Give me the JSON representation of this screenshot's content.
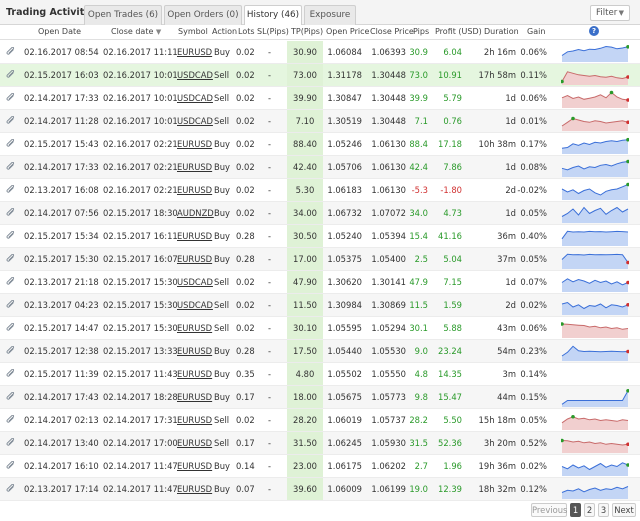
{
  "title": "Trading Activity",
  "tabs": [
    {
      "label": "Open Trades (6)",
      "active": false
    },
    {
      "label": "Open Orders (0)",
      "active": false
    },
    {
      "label": "History (46)",
      "active": true
    },
    {
      "label": "Exposure",
      "active": false
    }
  ],
  "filter": {
    "label": "Filter",
    "caret": "▼"
  },
  "columns": {
    "open_date": "Open Date",
    "close_date": "Close date",
    "close_sort": "▼",
    "symbol": "Symbol",
    "action": "Action",
    "lots": "Lots",
    "sl": "SL(Pips)",
    "tp": "TP(Pips)",
    "open_price": "Open Price",
    "close_price": "Close Price",
    "pips": "Pips",
    "profit": "Profit (USD)",
    "duration": "Duration",
    "gain": "Gain",
    "help": "?"
  },
  "colors": {
    "positive": "#2a9a2a",
    "negative": "#d03030",
    "spark_blue_line": "#3a6fd8",
    "spark_blue_fill": "#c3d5f5",
    "spark_red_line": "#c86a6a",
    "spark_red_fill": "#f1cfcf",
    "highlight_row": "#e5f6df"
  },
  "rows": [
    {
      "open": "02.16.2017 08:54",
      "close": "02.16.2017 11:11",
      "symbol": "EURUSD",
      "action": "Buy",
      "lots": "0.02",
      "sl": "-",
      "tp": "30.90",
      "open_price": "1.06084",
      "close_price": "1.06393",
      "pips": "30.9",
      "profit": "6.04",
      "duration": "2h 16m",
      "gain": "0.06%",
      "neg": false,
      "spark": {
        "color": "blue",
        "values": [
          0.3,
          0.55,
          0.6,
          0.7,
          0.62,
          0.72,
          0.7,
          0.78,
          0.9,
          0.86,
          0.75,
          0.8,
          0.88
        ],
        "end": "green"
      }
    },
    {
      "open": "02.15.2017 16:03",
      "close": "02.16.2017 10:01",
      "symbol": "USDCAD",
      "action": "Sell",
      "lots": "0.02",
      "sl": "-",
      "tp": "73.00",
      "open_price": "1.31178",
      "close_price": "1.30448",
      "pips": "73.0",
      "profit": "10.91",
      "duration": "17h 58m",
      "gain": "0.11%",
      "neg": false,
      "highlight": true,
      "spark": {
        "color": "red",
        "values": [
          0.1,
          0.75,
          0.65,
          0.55,
          0.5,
          0.45,
          0.5,
          0.42,
          0.38,
          0.45,
          0.35,
          0.3,
          0.4
        ],
        "end": "red",
        "start": "green"
      }
    },
    {
      "open": "02.14.2017 17:33",
      "close": "02.16.2017 10:01",
      "symbol": "USDCAD",
      "action": "Sell",
      "lots": "0.02",
      "sl": "-",
      "tp": "39.90",
      "open_price": "1.30847",
      "close_price": "1.30448",
      "pips": "39.9",
      "profit": "5.79",
      "duration": "1d",
      "gain": "0.06%",
      "neg": false,
      "spark": {
        "color": "red",
        "values": [
          0.55,
          0.7,
          0.5,
          0.6,
          0.45,
          0.52,
          0.6,
          0.75,
          0.55,
          0.9,
          0.6,
          0.45,
          0.4
        ],
        "end": "red",
        "peak": "green"
      }
    },
    {
      "open": "02.14.2017 11:28",
      "close": "02.16.2017 10:01",
      "symbol": "USDCAD",
      "action": "Sell",
      "lots": "0.02",
      "sl": "-",
      "tp": "7.10",
      "open_price": "1.30519",
      "close_price": "1.30448",
      "pips": "7.1",
      "profit": "0.76",
      "duration": "1d",
      "gain": "0.01%",
      "neg": false,
      "spark": {
        "color": "red",
        "values": [
          0.2,
          0.45,
          0.7,
          0.6,
          0.5,
          0.45,
          0.55,
          0.5,
          0.4,
          0.45,
          0.5,
          0.55,
          0.45
        ],
        "end": "red",
        "peak": "green"
      }
    },
    {
      "open": "02.15.2017 15:43",
      "close": "02.16.2017 02:21",
      "symbol": "EURUSD",
      "action": "Buy",
      "lots": "0.02",
      "sl": "-",
      "tp": "88.40",
      "open_price": "1.05246",
      "close_price": "1.06130",
      "pips": "88.4",
      "profit": "17.18",
      "duration": "10h 38m",
      "gain": "0.17%",
      "neg": false,
      "spark": {
        "color": "blue",
        "values": [
          0.25,
          0.3,
          0.55,
          0.45,
          0.6,
          0.5,
          0.65,
          0.6,
          0.7,
          0.75,
          0.7,
          0.78,
          0.82
        ],
        "end": "green"
      }
    },
    {
      "open": "02.14.2017 17:33",
      "close": "02.16.2017 02:21",
      "symbol": "EURUSD",
      "action": "Buy",
      "lots": "0.02",
      "sl": "-",
      "tp": "42.40",
      "open_price": "1.05706",
      "close_price": "1.06130",
      "pips": "42.4",
      "profit": "7.86",
      "duration": "1d",
      "gain": "0.08%",
      "neg": false,
      "spark": {
        "color": "blue",
        "values": [
          0.45,
          0.35,
          0.5,
          0.6,
          0.4,
          0.55,
          0.5,
          0.65,
          0.7,
          0.6,
          0.75,
          0.85,
          0.9
        ],
        "end": "green"
      }
    },
    {
      "open": "02.13.2017 16:08",
      "close": "02.16.2017 02:21",
      "symbol": "EURUSD",
      "action": "Buy",
      "lots": "0.02",
      "sl": "-",
      "tp": "5.30",
      "open_price": "1.06183",
      "close_price": "1.06130",
      "pips": "-5.3",
      "profit": "-1.80",
      "duration": "2d",
      "gain": "-0.02%",
      "neg": true,
      "spark": {
        "color": "blue",
        "values": [
          0.6,
          0.4,
          0.55,
          0.3,
          0.5,
          0.6,
          0.35,
          0.2,
          0.45,
          0.55,
          0.6,
          0.75,
          0.9
        ],
        "end": "green"
      }
    },
    {
      "open": "02.14.2017 07:56",
      "close": "02.15.2017 18:30",
      "symbol": "AUDNZD",
      "action": "Buy",
      "lots": "0.02",
      "sl": "-",
      "tp": "34.00",
      "open_price": "1.06732",
      "close_price": "1.07072",
      "pips": "34.0",
      "profit": "4.73",
      "duration": "1d",
      "gain": "0.05%",
      "neg": false,
      "spark": {
        "color": "blue",
        "values": [
          0.3,
          0.5,
          0.8,
          0.4,
          0.9,
          0.5,
          0.7,
          0.85,
          0.45,
          0.7,
          0.9,
          0.6,
          0.8
        ]
      }
    },
    {
      "open": "02.15.2017 15:34",
      "close": "02.15.2017 16:11",
      "symbol": "EURUSD",
      "action": "Buy",
      "lots": "0.28",
      "sl": "-",
      "tp": "30.50",
      "open_price": "1.05240",
      "close_price": "1.05394",
      "pips": "15.4",
      "profit": "41.16",
      "duration": "36m",
      "gain": "0.40%",
      "neg": false,
      "spark": {
        "color": "blue",
        "values": [
          0.35,
          0.85,
          0.8,
          0.82,
          0.8,
          0.84,
          0.82,
          0.83,
          0.8,
          0.82,
          0.84,
          0.83,
          0.8
        ]
      }
    },
    {
      "open": "02.15.2017 15:30",
      "close": "02.15.2017 16:07",
      "symbol": "EURUSD",
      "action": "Buy",
      "lots": "0.28",
      "sl": "-",
      "tp": "17.00",
      "open_price": "1.05375",
      "close_price": "1.05400",
      "pips": "2.5",
      "profit": "5.04",
      "duration": "37m",
      "gain": "0.05%",
      "neg": false,
      "spark": {
        "color": "blue",
        "values": [
          0.5,
          0.85,
          0.82,
          0.83,
          0.8,
          0.84,
          0.82,
          0.83,
          0.81,
          0.83,
          0.84,
          0.82,
          0.3
        ],
        "end": "red"
      }
    },
    {
      "open": "02.13.2017 21:18",
      "close": "02.15.2017 15:30",
      "symbol": "USDCAD",
      "action": "Sell",
      "lots": "0.02",
      "sl": "-",
      "tp": "47.90",
      "open_price": "1.30620",
      "close_price": "1.30141",
      "pips": "47.9",
      "profit": "7.15",
      "duration": "1d",
      "gain": "0.07%",
      "neg": false,
      "spark": {
        "color": "blue",
        "values": [
          0.5,
          0.75,
          0.55,
          0.7,
          0.6,
          0.45,
          0.65,
          0.5,
          0.6,
          0.4,
          0.55,
          0.35,
          0.5
        ],
        "end": "red"
      }
    },
    {
      "open": "02.13.2017 04:23",
      "close": "02.15.2017 15:30",
      "symbol": "USDCAD",
      "action": "Sell",
      "lots": "0.02",
      "sl": "-",
      "tp": "11.50",
      "open_price": "1.30984",
      "close_price": "1.30869",
      "pips": "11.5",
      "profit": "1.59",
      "duration": "2d",
      "gain": "0.02%",
      "neg": false,
      "spark": {
        "color": "blue",
        "values": [
          0.6,
          0.7,
          0.4,
          0.55,
          0.3,
          0.5,
          0.45,
          0.6,
          0.35,
          0.55,
          0.5,
          0.4,
          0.55
        ],
        "end": "red"
      }
    },
    {
      "open": "02.15.2017 14:47",
      "close": "02.15.2017 15:30",
      "symbol": "EURUSD",
      "action": "Sell",
      "lots": "0.02",
      "sl": "-",
      "tp": "30.10",
      "open_price": "1.05595",
      "close_price": "1.05294",
      "pips": "30.1",
      "profit": "5.88",
      "duration": "43m",
      "gain": "0.06%",
      "neg": false,
      "spark": {
        "color": "red",
        "values": [
          0.8,
          0.78,
          0.75,
          0.72,
          0.7,
          0.6,
          0.65,
          0.55,
          0.6,
          0.5,
          0.55,
          0.45,
          0.5
        ],
        "peak": "green"
      }
    },
    {
      "open": "02.15.2017 12:38",
      "close": "02.15.2017 13:33",
      "symbol": "EURUSD",
      "action": "Buy",
      "lots": "0.28",
      "sl": "-",
      "tp": "17.50",
      "open_price": "1.05440",
      "close_price": "1.05530",
      "pips": "9.0",
      "profit": "23.24",
      "duration": "54m",
      "gain": "0.23%",
      "neg": false,
      "spark": {
        "color": "blue",
        "values": [
          0.2,
          0.45,
          0.85,
          0.55,
          0.5,
          0.52,
          0.5,
          0.48,
          0.5,
          0.52,
          0.5,
          0.48,
          0.5
        ],
        "end": "red"
      }
    },
    {
      "open": "02.15.2017 11:39",
      "close": "02.15.2017 11:43",
      "symbol": "EURUSD",
      "action": "Buy",
      "lots": "0.35",
      "sl": "-",
      "tp": "4.80",
      "open_price": "1.05502",
      "close_price": "1.05550",
      "pips": "4.8",
      "profit": "14.35",
      "duration": "3m",
      "gain": "0.14%",
      "neg": false,
      "spark": null
    },
    {
      "open": "02.14.2017 17:43",
      "close": "02.14.2017 18:28",
      "symbol": "EURUSD",
      "action": "Buy",
      "lots": "0.17",
      "sl": "-",
      "tp": "18.00",
      "open_price": "1.05675",
      "close_price": "1.05773",
      "pips": "9.8",
      "profit": "15.47",
      "duration": "44m",
      "gain": "0.15%",
      "neg": false,
      "spark": {
        "color": "blue",
        "values": [
          0.05,
          0.3,
          0.3,
          0.3,
          0.3,
          0.3,
          0.3,
          0.3,
          0.3,
          0.3,
          0.3,
          0.3,
          0.95
        ],
        "end": "green"
      }
    },
    {
      "open": "02.14.2017 02:13",
      "close": "02.14.2017 17:31",
      "symbol": "EURUSD",
      "action": "Sell",
      "lots": "0.02",
      "sl": "-",
      "tp": "28.20",
      "open_price": "1.06019",
      "close_price": "1.05737",
      "pips": "28.2",
      "profit": "5.50",
      "duration": "15h 18m",
      "gain": "0.05%",
      "neg": false,
      "spark": {
        "color": "red",
        "values": [
          0.35,
          0.6,
          0.75,
          0.6,
          0.65,
          0.55,
          0.6,
          0.5,
          0.55,
          0.5,
          0.45,
          0.55,
          0.5
        ],
        "peak": "green"
      }
    },
    {
      "open": "02.14.2017 13:40",
      "close": "02.14.2017 17:00",
      "symbol": "EURUSD",
      "action": "Sell",
      "lots": "0.17",
      "sl": "-",
      "tp": "31.50",
      "open_price": "1.06245",
      "close_price": "1.05930",
      "pips": "31.5",
      "profit": "52.36",
      "duration": "3h 20m",
      "gain": "0.52%",
      "neg": false,
      "spark": {
        "color": "red",
        "values": [
          0.7,
          0.68,
          0.6,
          0.65,
          0.55,
          0.6,
          0.5,
          0.55,
          0.45,
          0.5,
          0.45,
          0.4,
          0.45
        ],
        "start": "green",
        "end": "red"
      }
    },
    {
      "open": "02.14.2017 16:10",
      "close": "02.14.2017 11:47",
      "symbol": "EURUSD",
      "action": "Buy",
      "lots": "0.14",
      "sl": "-",
      "tp": "23.00",
      "open_price": "1.06175",
      "close_price": "1.06202",
      "pips": "2.7",
      "profit": "1.96",
      "duration": "19h 36m",
      "gain": "0.02%",
      "neg": false,
      "spark": {
        "color": "blue",
        "values": [
          0.5,
          0.35,
          0.6,
          0.4,
          0.55,
          0.3,
          0.5,
          0.7,
          0.45,
          0.6,
          0.5,
          0.75,
          0.6
        ],
        "end": "green"
      }
    },
    {
      "open": "02.13.2017 17:14",
      "close": "02.14.2017 11:47",
      "symbol": "EURUSD",
      "action": "Buy",
      "lots": "0.07",
      "sl": "-",
      "tp": "39.60",
      "open_price": "1.06009",
      "close_price": "1.06199",
      "pips": "19.0",
      "profit": "12.39",
      "duration": "18h 32m",
      "gain": "0.12%",
      "neg": false,
      "spark": {
        "color": "blue",
        "values": [
          0.3,
          0.45,
          0.4,
          0.55,
          0.35,
          0.5,
          0.6,
          0.45,
          0.55,
          0.5,
          0.65,
          0.55,
          0.7
        ]
      }
    }
  ],
  "pagination": {
    "previous": "Previous",
    "pages": [
      "1",
      "2",
      "3"
    ],
    "current": "1",
    "next": "Next"
  }
}
